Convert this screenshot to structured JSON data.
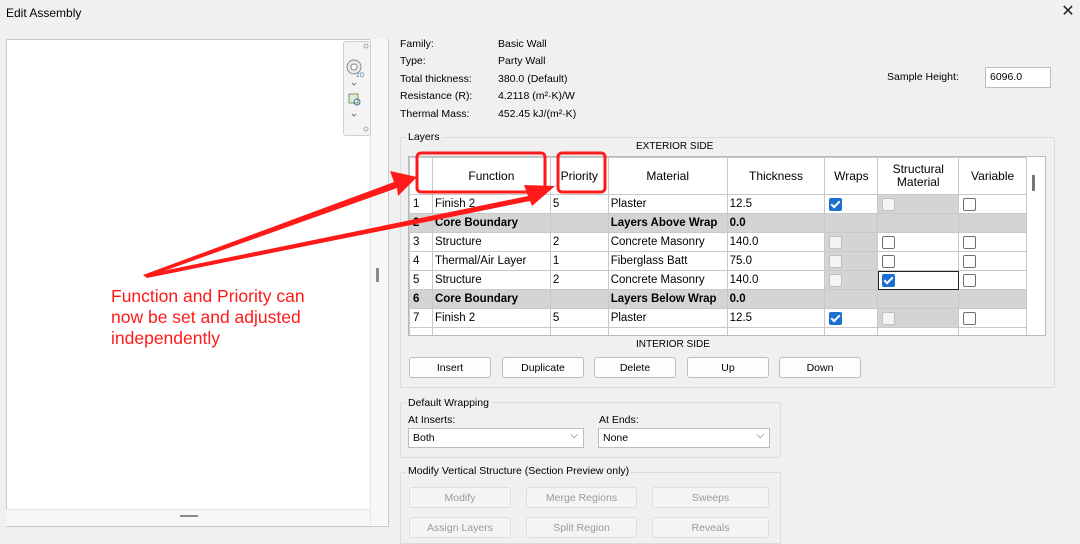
{
  "window": {
    "title": "Edit Assembly",
    "close_label": "✕"
  },
  "properties": {
    "family_label": "Family:",
    "family_value": "Basic Wall",
    "type_label": "Type:",
    "type_value": "Party Wall",
    "thickness_label": "Total thickness:",
    "thickness_value": "380.0 (Default)",
    "resistance_label": "Resistance (R):",
    "resistance_value": "4.2118 (m²·K)/W",
    "mass_label": "Thermal Mass:",
    "mass_value": "452.45 kJ/(m²·K)",
    "sample_height_label": "Sample Height:",
    "sample_height_value": "6096.0"
  },
  "layers": {
    "group_label": "Layers",
    "exterior_label": "EXTERIOR SIDE",
    "interior_label": "INTERIOR SIDE",
    "columns": [
      "",
      "Function",
      "Priority",
      "Material",
      "Thickness",
      "Wraps",
      "Structural Material",
      "Variable"
    ],
    "rows": [
      {
        "num": "1",
        "function": "Finish 2",
        "priority": "5",
        "material": "Plaster",
        "thickness": "12.5",
        "wraps": "checked",
        "structural": "disabled",
        "variable": "unchecked"
      },
      {
        "num": "2",
        "function": "Core Boundary",
        "priority": "",
        "material": "Layers Above Wrap",
        "thickness": "0.0",
        "core": true
      },
      {
        "num": "3",
        "function": "Structure",
        "priority": "2",
        "material": "Concrete Masonry",
        "thickness": "140.0",
        "wraps": "disabled",
        "structural": "unchecked",
        "variable": "unchecked"
      },
      {
        "num": "4",
        "function": "Thermal/Air Layer",
        "priority": "1",
        "material": "Fiberglass Batt",
        "thickness": "75.0",
        "wraps": "disabled",
        "structural": "unchecked",
        "variable": "unchecked"
      },
      {
        "num": "5",
        "function": "Structure",
        "priority": "2",
        "material": "Concrete Masonry",
        "thickness": "140.0",
        "wraps": "disabled",
        "structural": "checked",
        "variable": "unchecked"
      },
      {
        "num": "6",
        "function": "Core Boundary",
        "priority": "",
        "material": "Layers Below Wrap",
        "thickness": "0.0",
        "core": true
      },
      {
        "num": "7",
        "function": "Finish 2",
        "priority": "5",
        "material": "Plaster",
        "thickness": "12.5",
        "wraps": "checked",
        "structural": "disabled",
        "variable": "unchecked"
      }
    ],
    "buttons": {
      "insert": "Insert",
      "duplicate": "Duplicate",
      "delete": "Delete",
      "up": "Up",
      "down": "Down"
    }
  },
  "wrapping": {
    "group_label": "Default Wrapping",
    "inserts_label": "At Inserts:",
    "inserts_value": "Both",
    "ends_label": "At  Ends:",
    "ends_value": "None"
  },
  "modify": {
    "group_label": "Modify Vertical Structure (Section Preview only)",
    "buttons": {
      "modify": "Modify",
      "merge": "Merge Regions",
      "sweeps": "Sweeps",
      "assign": "Assign Layers",
      "split": "Split Region",
      "reveals": "Reveals"
    }
  },
  "annotation": {
    "line1": "Function and Priority can",
    "line2": "now be set and adjusted",
    "line3": "independently",
    "color": "#ff1a1a"
  }
}
